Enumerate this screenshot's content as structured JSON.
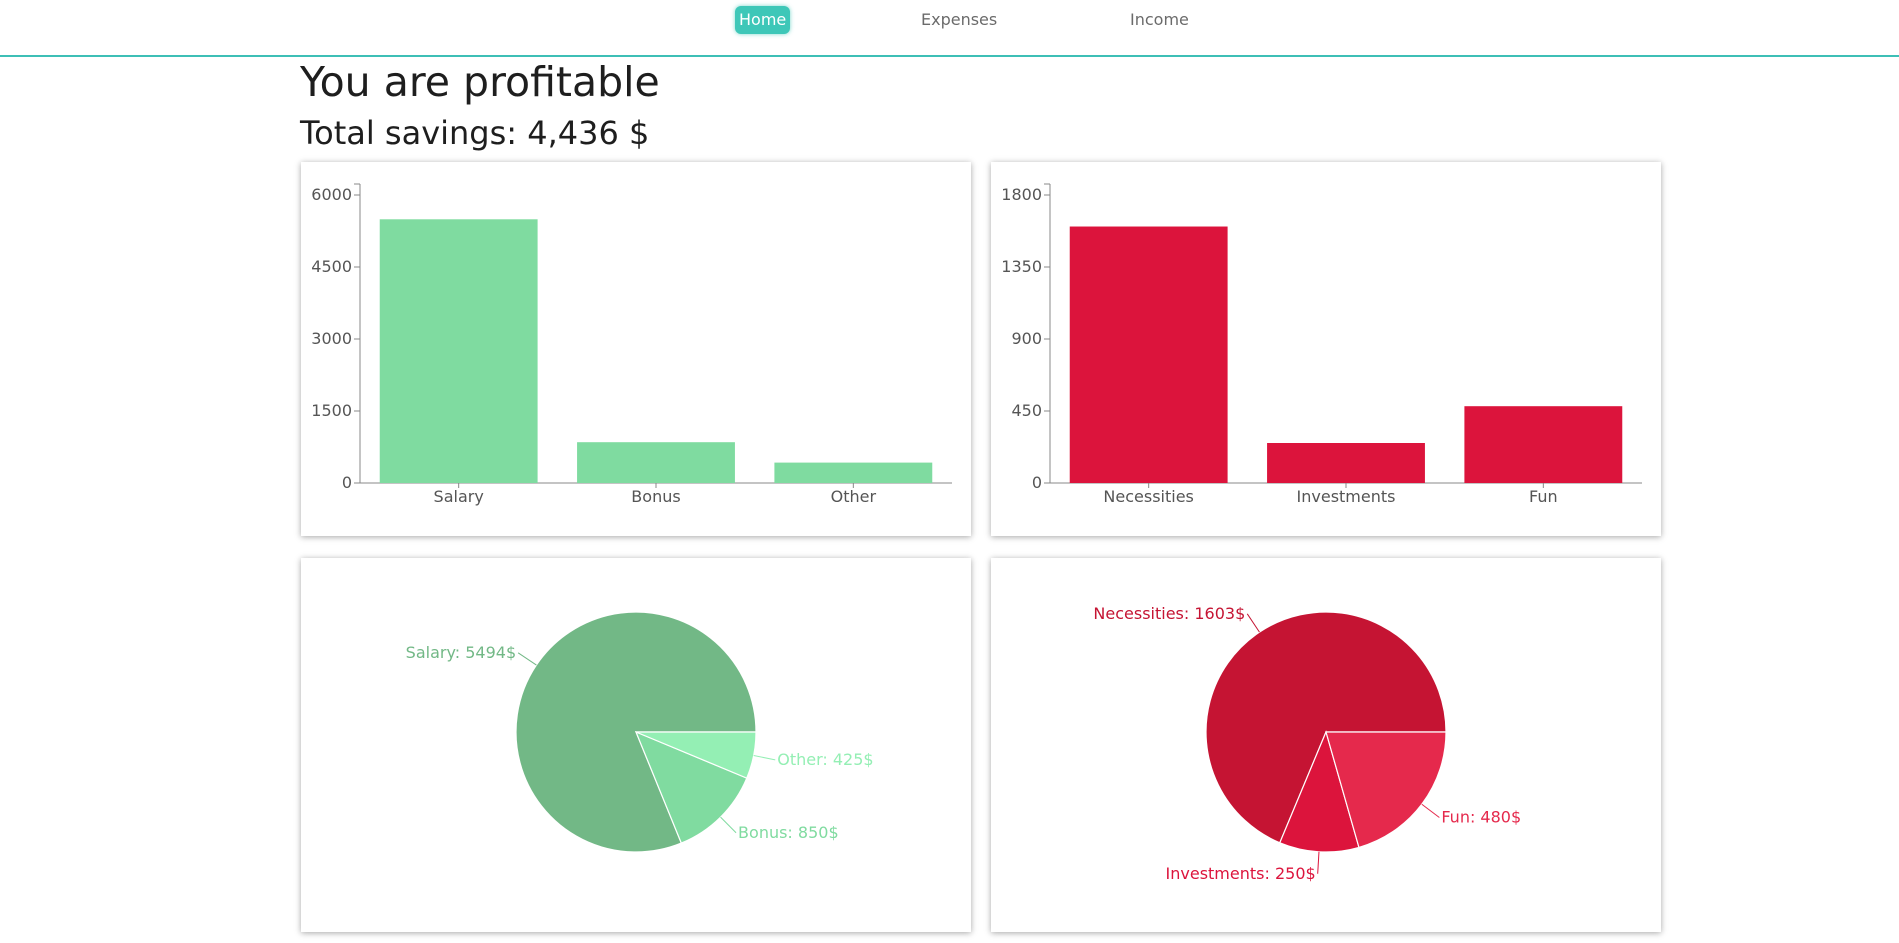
{
  "nav": {
    "items": [
      {
        "label": "Home",
        "active": true
      },
      {
        "label": "Expenses",
        "active": false
      },
      {
        "label": "Income",
        "active": false
      }
    ]
  },
  "status": {
    "headline": "You are profitable",
    "savings": "Total savings: 4,436 $"
  },
  "colors": {
    "accent": "#3ec7b8",
    "income_bar": "#7fdba0",
    "expense_bar": "#dc143c",
    "income_pie": [
      "#72b886",
      "#80dba0",
      "#94efb4"
    ],
    "expense_pie": [
      "#c51433",
      "#dc143c",
      "#e5294c"
    ]
  },
  "chart_data": [
    {
      "type": "bar",
      "categories": [
        "Salary",
        "Bonus",
        "Other"
      ],
      "values": [
        5494,
        850,
        425
      ],
      "ylim": [
        0,
        6000
      ],
      "yticks": [
        0,
        1500,
        3000,
        4500,
        6000
      ],
      "color": "#7fdba0"
    },
    {
      "type": "bar",
      "categories": [
        "Necessities",
        "Investments",
        "Fun"
      ],
      "values": [
        1603,
        250,
        480
      ],
      "ylim": [
        0,
        1800
      ],
      "yticks": [
        0,
        450,
        900,
        1350,
        1800
      ],
      "color": "#dc143c"
    },
    {
      "type": "pie",
      "labels": [
        "Salary: 5494$",
        "Bonus: 850$",
        "Other: 425$"
      ],
      "values": [
        5494,
        850,
        425
      ],
      "colors": [
        "#72b886",
        "#80dba0",
        "#94efb4"
      ]
    },
    {
      "type": "pie",
      "labels": [
        "Necessities: 1603$",
        "Investments: 250$",
        "Fun: 480$"
      ],
      "values": [
        1603,
        250,
        480
      ],
      "colors": [
        "#c51433",
        "#dc143c",
        "#e5294c"
      ]
    }
  ]
}
